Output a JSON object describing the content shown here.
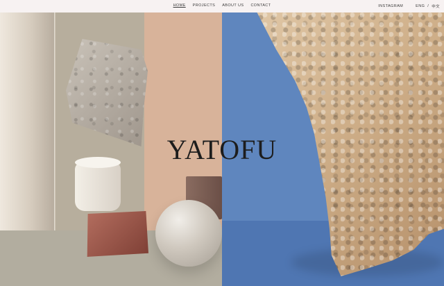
{
  "nav": {
    "items": [
      {
        "label": "HOME",
        "active": true
      },
      {
        "label": "PROJECTS",
        "active": false
      },
      {
        "label": "ABOUT US",
        "active": false
      },
      {
        "label": "CONTACT",
        "active": false
      }
    ]
  },
  "header_right": {
    "instagram_label": "INSTAGRAM",
    "lang_en": "ENG",
    "lang_sep": "/",
    "lang_zh": "中文"
  },
  "hero": {
    "brand": "YATOFU"
  }
}
